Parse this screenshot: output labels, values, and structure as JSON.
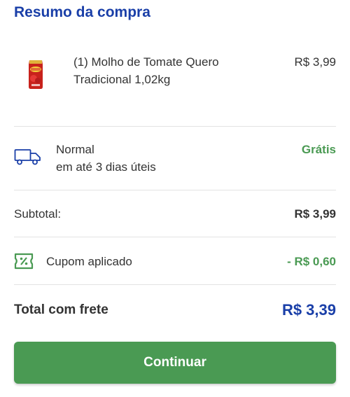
{
  "header": {
    "title": "Resumo da compra"
  },
  "product": {
    "name": "(1) Molho de Tomate Quero Tradicional 1,02kg",
    "price": "R$ 3,99",
    "thumbnail_icon": "tomato-sauce-pouch"
  },
  "shipping": {
    "name": "Normal",
    "time": "em até 3 dias úteis",
    "price": "Grátis",
    "icon": "truck-icon"
  },
  "subtotal": {
    "label": "Subtotal:",
    "value": "R$ 3,99"
  },
  "coupon": {
    "label": "Cupom aplicado",
    "value": "- R$ 0,60",
    "icon": "coupon-icon"
  },
  "total": {
    "label": "Total com frete",
    "value": "R$ 3,39"
  },
  "actions": {
    "continue_label": "Continuar"
  },
  "colors": {
    "brand_blue": "#1a3fa8",
    "accent_green": "#4a9a53"
  }
}
